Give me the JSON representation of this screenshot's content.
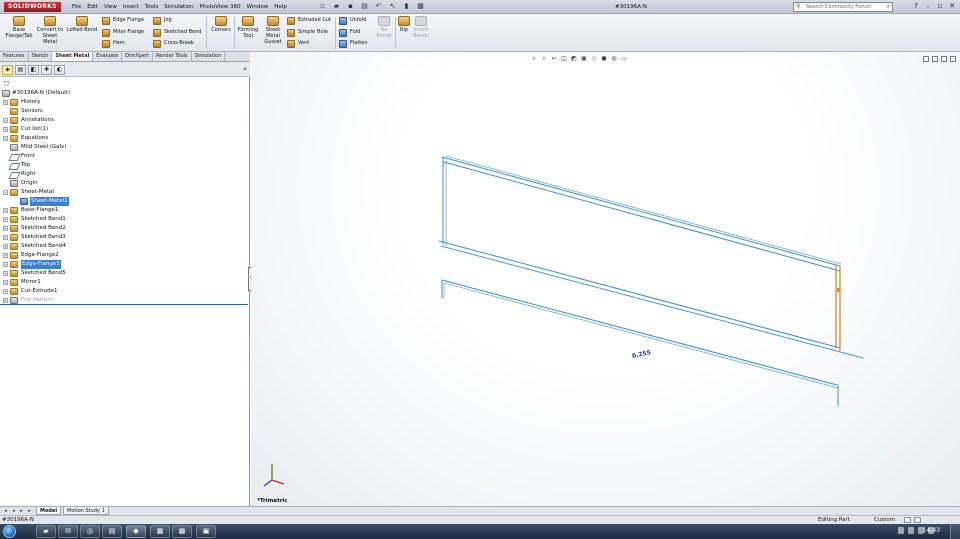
{
  "app": {
    "logo_text": "SOLIDWORKS",
    "doc_title": "#30196A-N",
    "menu": [
      "File",
      "Edit",
      "View",
      "Insert",
      "Tools",
      "Simulation",
      "PhotoView 360",
      "Window",
      "Help"
    ],
    "search_placeholder": "Search Community Forum"
  },
  "ribbon": {
    "base_flange": "Base Flange/Tab",
    "convert": "Convert to Sheet Metal",
    "lofted_bend": "Lofted-Bend",
    "edge_flange": "Edge Flange",
    "miter_flange": "Miter Flange",
    "hem": "Hem",
    "jog": "Jog",
    "sketched_bend": "Sketched Bend",
    "cross_break": "Cross-Break",
    "corners": "Corners",
    "forming_tool": "Forming Tool",
    "gusset": "Sheet Metal Gusset",
    "extruded_cut": "Extruded Cut",
    "simple_hole": "Simple Hole",
    "vent": "Vent",
    "unfold": "Unfold",
    "fold": "Fold",
    "flatten": "Flatten",
    "no_bends": "No Bends",
    "rip": "Rip",
    "insert_bends": "Insert Bends"
  },
  "command_tabs": [
    "Features",
    "Sketch",
    "Sheet Metal",
    "Evaluate",
    "DimXpert",
    "Render Tools",
    "Simulation"
  ],
  "active_command_tab": "Sheet Metal",
  "tree": {
    "root": "#30196A-N  (Default)",
    "items": [
      {
        "label": "History"
      },
      {
        "label": "Sensors"
      },
      {
        "label": "Annotations"
      },
      {
        "label": "Cut list(1)"
      },
      {
        "label": "Equations"
      },
      {
        "label": "Mild Steel (Galv)"
      },
      {
        "label": "Front"
      },
      {
        "label": "Top"
      },
      {
        "label": "Right"
      },
      {
        "label": "Origin"
      },
      {
        "label": "Sheet-Metal"
      },
      {
        "label": "Sheet-Metal1"
      },
      {
        "label": "Base-Flange1"
      },
      {
        "label": "Sketched Bend1"
      },
      {
        "label": "Sketched Bend2"
      },
      {
        "label": "Sketched Bend3"
      },
      {
        "label": "Sketched Bend4"
      },
      {
        "label": "Edge-Flange2"
      },
      {
        "label": "Edge-Flange3"
      },
      {
        "label": "Sketched Bend5"
      },
      {
        "label": "Mirror1"
      },
      {
        "label": "Cut-Extrude1"
      },
      {
        "label": "Flat-Pattern"
      }
    ]
  },
  "viewport": {
    "dimension": "0.255",
    "view_name": "*Trimetric",
    "model_color": "#3b8fd8",
    "highlight_color": "#e08a2a"
  },
  "bottom_tabs": [
    "Model",
    "Motion Study 1"
  ],
  "status": {
    "document": "#30196A-N",
    "mode": "Editing Part",
    "units": "Custom"
  },
  "taskbar": {
    "clock": "14:43"
  }
}
